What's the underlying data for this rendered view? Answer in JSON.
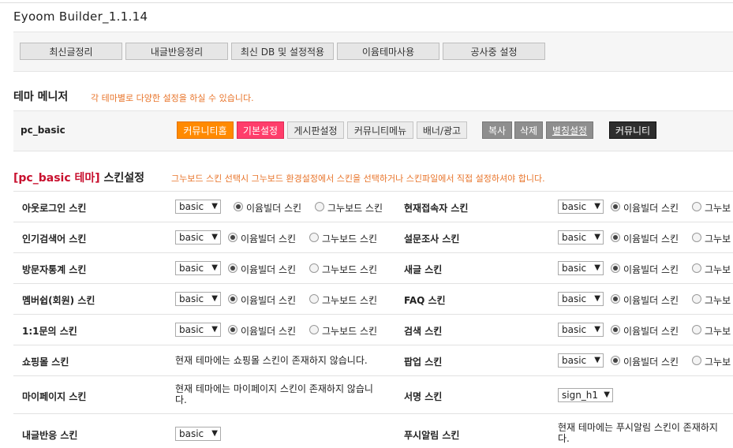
{
  "app_title": "Eyoom Builder_1.1.14",
  "toolbar": {
    "buttons": [
      "최신글정리",
      "내글반응정리",
      "최신 DB 및 설정적용",
      "이윰테마사용",
      "공사중 설정"
    ]
  },
  "theme_manager": {
    "title": "테마 메니저",
    "note": "각 테마별로 다양한 설정을 하실 수 있습니다.",
    "theme_name": "pc_basic",
    "buttons": [
      "커뮤니티홈",
      "기본설정",
      "게시판설정",
      "커뮤니티메뉴",
      "배너/광고",
      "복사",
      "삭제",
      "별칭설정",
      "커뮤니티"
    ]
  },
  "skin_settings": {
    "title_prefix": "[pc_basic 테마]",
    "title_suffix": " 스킨설정",
    "note": "그누보드 스킨 선택시 그누보드 환경설정에서 스킨을 선택하거나 스킨파일에서 직접 설정하셔야 합니다.",
    "option_eyoom": "이윰빌더 스킨",
    "option_gnu": "그누보드 스킨",
    "option_gnu_cut": "그누보",
    "default_select": "basic",
    "sign_select": "sign_h1",
    "left": [
      "아웃로그인 스킨",
      "인기검색어 스킨",
      "방문자통계 스킨",
      "멤버쉽(회원) 스킨",
      "1:1문의 스킨",
      "쇼핑몰 스킨",
      "마이페이지 스킨",
      "내글반응 스킨"
    ],
    "right": [
      "현재접속자 스킨",
      "설문조사 스킨",
      "새글 스킨",
      "FAQ 스킨",
      "검색 스킨",
      "팝업 스킨",
      "서명 스킨",
      "푸시알림 스킨"
    ],
    "shop_msg": "현재 테마에는 쇼핑몰 스킨이 존재하지 않습니다.",
    "mypage_msg_1": "현재 테마에는 마이페이지 스킨이 존재하지 않습니",
    "mypage_msg_2": "다.",
    "push_msg_1": "현재 테마에는 푸시알림 스킨이 존재하지",
    "push_msg_2": "다."
  },
  "colors": {
    "accent_orange": "#ff8a00",
    "accent_pink": "#ff3d6b",
    "note_orange": "#e8742a",
    "title_red": "#c8102e"
  }
}
